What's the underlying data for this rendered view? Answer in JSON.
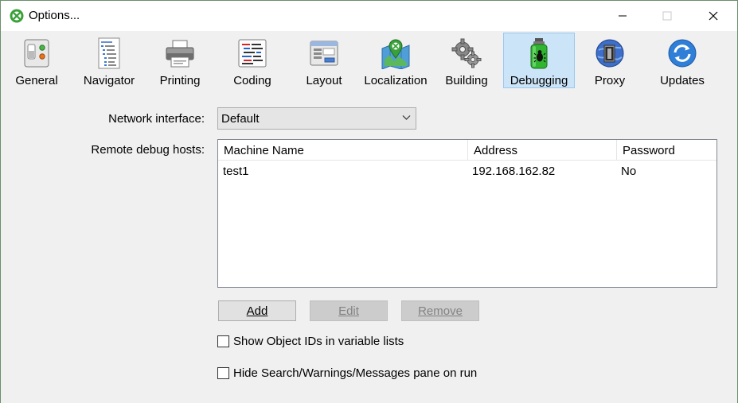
{
  "window": {
    "title": "Options..."
  },
  "toolbar": {
    "items": [
      {
        "label": "General",
        "icon": "general-switch-icon"
      },
      {
        "label": "Navigator",
        "icon": "navigator-tree-icon"
      },
      {
        "label": "Printing",
        "icon": "printer-icon"
      },
      {
        "label": "Coding",
        "icon": "code-editor-icon"
      },
      {
        "label": "Layout",
        "icon": "layout-window-icon"
      },
      {
        "label": "Localization",
        "icon": "map-pin-icon"
      },
      {
        "label": "Building",
        "icon": "gears-icon"
      },
      {
        "label": "Debugging",
        "icon": "bug-spray-icon"
      },
      {
        "label": "Proxy",
        "icon": "proxy-globe-icon"
      },
      {
        "label": "Updates",
        "icon": "refresh-icon"
      }
    ],
    "selected": "Debugging"
  },
  "debugging": {
    "network_interface_label": "Network interface:",
    "network_interface_value": "Default",
    "remote_hosts_label": "Remote debug hosts:",
    "columns": [
      "Machine Name",
      "Address",
      "Password"
    ],
    "rows": [
      {
        "machine_name": "test1",
        "address": "192.168.162.82",
        "password": "No"
      }
    ],
    "add_label": "Add",
    "edit_label": "Edit",
    "remove_label": "Remove",
    "show_object_ids_label": "Show Object IDs in variable lists",
    "show_object_ids_checked": false,
    "hide_pane_label": "Hide Search/Warnings/Messages pane on run",
    "hide_pane_checked": false
  },
  "colors": {
    "accent": "#cce4f7",
    "accent_border": "#99c9ef",
    "app_icon_green": "#3aa13a"
  }
}
